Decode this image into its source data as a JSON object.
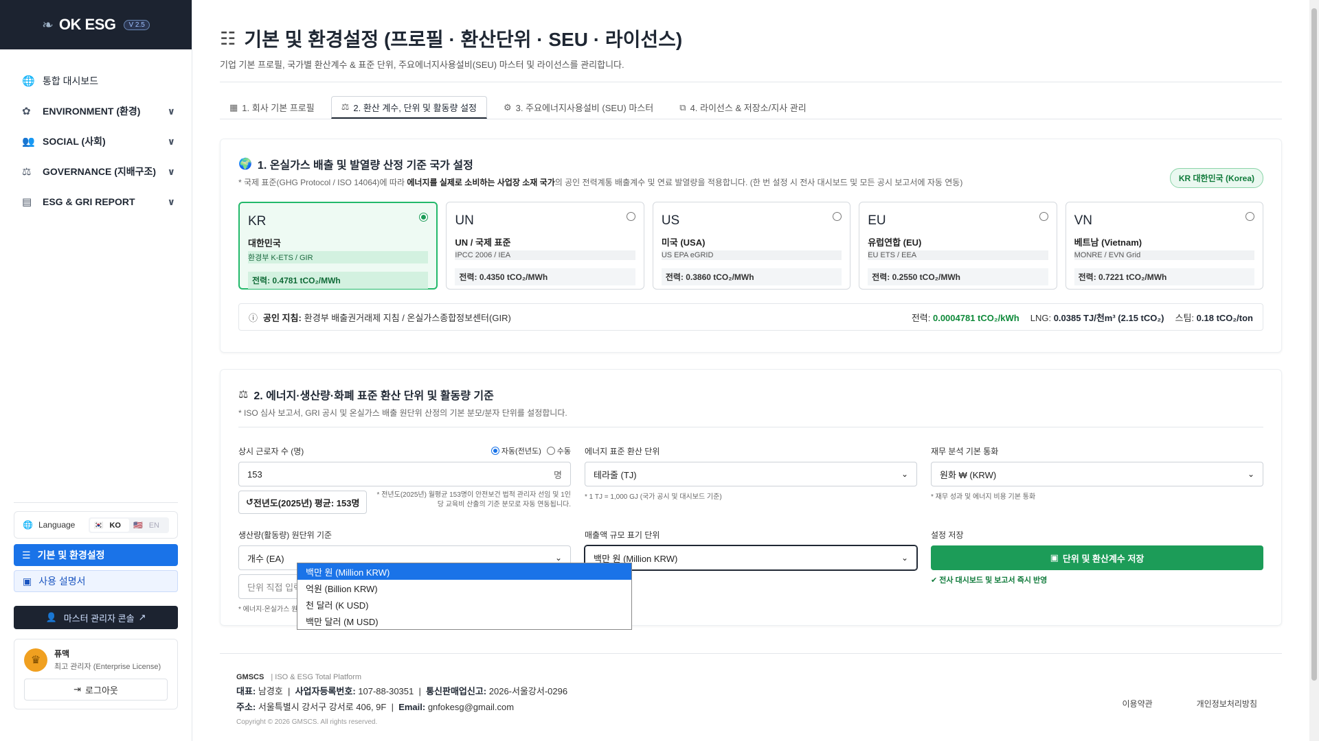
{
  "brand": {
    "name": "OK ESG",
    "version": "V 2.5"
  },
  "nav": [
    {
      "icon": "globe-icon",
      "label": "통합 대시보드",
      "chev": false
    },
    {
      "icon": "sprout-icon",
      "label": "ENVIRONMENT (환경)",
      "chev": true
    },
    {
      "icon": "users-icon",
      "label": "SOCIAL (사회)",
      "chev": true
    },
    {
      "icon": "scale-icon",
      "label": "GOVERNANCE (지배구조)",
      "chev": true
    },
    {
      "icon": "report-icon",
      "label": "ESG & GRI REPORT",
      "chev": true
    }
  ],
  "language": {
    "label": "Language",
    "ko": "KO",
    "en": "EN"
  },
  "sidebar_buttons": {
    "settings": "기본 및 환경설정",
    "manual": "사용 설명서",
    "master": "마스터 관리자 콘솔"
  },
  "user": {
    "name": "퓨맥",
    "role": "최고 관리자 (Enterprise License)",
    "logout": "로그아웃"
  },
  "page": {
    "title": "기본 및 환경설정 (프로필 · 환산단위 · SEU · 라이선스)",
    "subtitle": "기업 기본 프로필, 국가별 환산계수 & 표준 단위, 주요에너지사용설비(SEU) 마스터 및 라이선스를 관리합니다."
  },
  "tabs": [
    "1. 회사 기본 프로필",
    "2. 환산 계수, 단위 및 활동량 설정",
    "3. 주요에너지사용설비 (SEU) 마스터",
    "4. 라이선스 & 저장소/지사 관리"
  ],
  "section1": {
    "title": "1. 온실가스 배출 및 발열량 산정 기준 국가 설정",
    "sub_pre": "* 국제 표준(GHG Protocol / ISO 14064)에 따라 ",
    "sub_bold": "에너지를 실제로 소비하는 사업장 소재 국가",
    "sub_post": "의 공인 전력계통 배출계수 및 연료 발열량을 적용합니다. (한 번 설정 시 전사 대시보드 및 모든 공시 보고서에 자동 연동)",
    "badge": "KR 대한민국 (Korea)",
    "countries": [
      {
        "code": "KR",
        "name": "대한민국",
        "source": "환경부 K-ETS / GIR",
        "power": "전력: 0.4781 tCO₂/MWh",
        "selected": true
      },
      {
        "code": "UN",
        "name": "UN / 국제 표준",
        "source": "IPCC 2006 / IEA",
        "power": "전력: 0.4350 tCO₂/MWh",
        "selected": false
      },
      {
        "code": "US",
        "name": "미국 (USA)",
        "source": "US EPA eGRID",
        "power": "전력: 0.3860 tCO₂/MWh",
        "selected": false
      },
      {
        "code": "EU",
        "name": "유럽연합 (EU)",
        "source": "EU ETS / EEA",
        "power": "전력: 0.2550 tCO₂/MWh",
        "selected": false
      },
      {
        "code": "VN",
        "name": "베트남 (Vietnam)",
        "source": "MONRE / EVN Grid",
        "power": "전력: 0.7221 tCO₂/MWh",
        "selected": false
      }
    ],
    "guide": {
      "label": "공인 지침:",
      "value": "환경부 배출권거래제 지침 / 온실가스종합정보센터(GIR)",
      "power_label": "전력:",
      "power": "0.0004781 tCO₂/kWh",
      "lng_label": "LNG:",
      "lng": "0.0385 TJ/천m³ (2.15 tCO₂)",
      "steam_label": "스팀:",
      "steam": "0.18 tCO₂/ton"
    }
  },
  "section2": {
    "title": "2. 에너지·생산량·화폐 표준 환산 단위 및 활동량 기준",
    "sub": "* ISO 심사 보고서, GRI 공시 및 온실가스 배출 원단위 산정의 기본 분모/분자 단위를 설정합니다.",
    "workers": {
      "label": "상시 근로자 수 (명)",
      "auto": "자동(전년도)",
      "manual": "수동",
      "value": "153",
      "suffix": "명",
      "prev_btn": "전년도(2025년) 평균: 153명",
      "note": "* 전년도(2025년) 월평균 153명이 안전보건 법적 관리자 선임 및 1인당 교육비 산출의 기준 분모로 자동 연동됩니다."
    },
    "energy_unit": {
      "label": "에너지 표준 환산 단위",
      "value": "테라줄 (TJ)",
      "hint": "* 1 TJ = 1,000 GJ (국가 공시 및 대시보드 기준)"
    },
    "currency": {
      "label": "재무 분석 기본 통화",
      "value": "원화 ₩ (KRW)",
      "hint": "* 재무 성과 및 에너지 비용 기본 통화"
    },
    "production": {
      "label": "생산량(활동량) 원단위 기준",
      "value": "개수 (EA)",
      "placeholder": "단위 직접 입력 (예: m, box, 세트)",
      "hint": "* 에너지·온실가스 원단위(Intensity) 분모 단위"
    },
    "revenue": {
      "label": "매출액 규모 표기 단위",
      "value": "백만 원 (Million KRW)",
      "options": [
        "백만 원 (Million KRW)",
        "억원 (Billion KRW)",
        "천 달러 (K USD)",
        "백만 달러 (M USD)"
      ]
    },
    "save": {
      "label": "설정 저장",
      "button": "단위 및 환산계수 저장",
      "note": "전사 대시보드 및 보고서 즉시 반영"
    }
  },
  "footer": {
    "company": "GMSCS",
    "tagline": "ISO & ESG Total Platform",
    "rep_label": "대표:",
    "rep": "남경호",
    "biz_label": "사업자등록번호:",
    "biz": "107-88-30351",
    "sales_label": "통신판매업신고:",
    "sales": "2026-서울강서-0296",
    "addr_label": "주소:",
    "addr": "서울특별시 강서구 강서로 406, 9F",
    "email_label": "Email:",
    "email": "gnfokesg@gmail.com",
    "copyright": "Copyright © 2026 GMSCS. All rights reserved.",
    "terms": "이용약관",
    "privacy": "개인정보처리방침"
  }
}
